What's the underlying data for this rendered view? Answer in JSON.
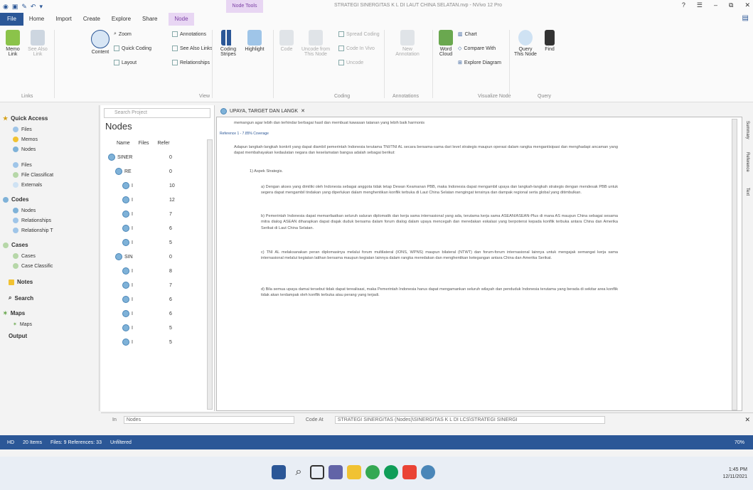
{
  "titlebar": {
    "context_tab": "Node Tools",
    "window_title": "STRATEGI SINERGITAS K L DI LAUT CHINA SELATAN.nvp - NVivo 12 Pro",
    "help": "?",
    "ribbon_opt": "☰",
    "minimize": "–",
    "restore": "⧉",
    "close": "✕"
  },
  "tabs": [
    "File",
    "Home",
    "Import",
    "Create",
    "Explore",
    "Share",
    "Node"
  ],
  "ribbon": {
    "memo_link": "Memo Link",
    "see_also_link": "See Also Link",
    "group_links": "Links",
    "content": "Content",
    "zoom": "Zoom",
    "quick_coding": "Quick Coding",
    "layout": "Layout",
    "annotations": "Annotations",
    "see_also_links": "See Also Links",
    "relationships": "Relationships",
    "group_view": "View",
    "coding_stripes": "Coding Stripes",
    "highlight": "Highlight",
    "code": "Code",
    "uncode_from": "Uncode from This Node",
    "spread_coding": "Spread Coding",
    "code_in_vivo": "Code In Vivo",
    "uncode": "Uncode",
    "group_coding": "Coding",
    "new_annotation": "New Annotation",
    "group_annotations": "Annotations",
    "word_cloud": "Word Cloud",
    "chart": "Chart",
    "compare_with": "Compare With",
    "explore_diagram": "Explore Diagram",
    "group_visualize": "Visualize Node",
    "query_this_node": "Query This Node",
    "find": "Find",
    "group_query": "Query"
  },
  "nav": {
    "quick_access": "Quick Access",
    "files": "Files",
    "memos": "Memos",
    "nodes": "Nodes",
    "files2": "Files",
    "file_classifications": "File Classificat",
    "externals": "Externals",
    "codes": "Codes",
    "nodes2": "Nodes",
    "relationships": "Relationships",
    "relationship_types": "Relationship T",
    "cases": "Cases",
    "cases2": "Cases",
    "case_classifications": "Case Classific",
    "notes": "Notes",
    "search": "Search",
    "maps": "Maps",
    "maps2": "Maps",
    "output": "Output"
  },
  "nodes_pane": {
    "search_placeholder": "Search Project",
    "title": "Nodes",
    "col_name": "Name",
    "col_files": "Files",
    "col_refs": "Refer",
    "rows": [
      {
        "name": "SINER",
        "files": "0"
      },
      {
        "name": "RE",
        "files": "0"
      },
      {
        "name": "I",
        "files": "10"
      },
      {
        "name": "I",
        "files": "12"
      },
      {
        "name": "I",
        "files": "7"
      },
      {
        "name": "I",
        "files": "6"
      },
      {
        "name": "I",
        "files": "5"
      },
      {
        "name": "SIN",
        "files": "0"
      },
      {
        "name": "I",
        "files": "8"
      },
      {
        "name": "I",
        "files": "7"
      },
      {
        "name": "I",
        "files": "6"
      },
      {
        "name": "I",
        "files": "6"
      },
      {
        "name": "I",
        "files": "5"
      },
      {
        "name": "I",
        "files": "5"
      }
    ]
  },
  "document": {
    "tab_title": "UPAYA, TARGET DAN LANGK",
    "top_line": "memangun agar lebih dan terhindar berbagai hasil dan membuat kawasan tatanan yang lebih baik harmonis",
    "ref_header": "Reference 1 - 7.85% Coverage",
    "para1": "Adapun langkah-langkah konkrit yang dapat diambil pemerintah Indonesia terutama TNI/TNI AL secara bersama-sama dari level strategis maupun operasi dalam rangka mengantisipasi dan menghadapi ancaman yang dapat membahayakan kedaulatan negara dan keselamatan bangsa adalah sebagai berikut:",
    "item1": "1)      Aspek Strategis.",
    "para_a": "a)      Dengan akses yang dimiliki oleh Indonesia sebagai anggota tidak tetap Dewan Keamanan PBB, maka Indonesia dapat mengambil upaya dan langkah-langkah strategis dengan mendesak PBB untuk segera dapat mengambil tindakan yang diperlukan dalam menghentikan konflik terbuka di Laut China Selatan mengingat tensinya dan dampak regional serta global yang ditimbulkan.",
    "para_b": "b)      Pemerintah Indonesia dapat memanfaatkan seluruh saluran diplomatik dan kerja sama internasional yang ada, terutama kerja sama ASEAN/ASEAN-Plus di mana AS maupun China sebagai sesama mitra dialog ASEAN diharapkan dapat diajak duduk bersama dalam forum dialog dalam upaya mencegah dan meredakan eskalasi yang berpotensi kepada konflik terbuka antara China dan Amerika Serikat di Laut China Selatan.",
    "para_c": "c)      TNI AL melaksanakan peran diplomasinya melalui forum multilateral (IONS, WPNS) maupun bilateral (NTWT) dan forum-forum internasional lainnya untuk mengajak semangat kerja sama internasional melalui kegiatan latihan bersama maupun kegiatan lainnya dalam rangka meredakan dan menghentikan ketegangan antara China dan Amerika Serikat.",
    "para_d": "d)      Bila semua upaya damai tersebut tidak dapat terealisasi, maka Pemerintah Indonesia harus dapat mengamankan seluruh wilayah dan penduduk Indonesia terutama yang berada di sekitar area konflik tidak akan terdampak oleh konflik terbuka atau perang yang terjadi.",
    "side_summary": "Summary",
    "side_reference": "Reference",
    "side_text": "Text"
  },
  "codebar": {
    "in": "In",
    "nodes": "Nodes",
    "code_at": "Code At",
    "node_path": "STRATEGI SINERGITAS (Nodes)\\SINERGITAS K L DI LCS\\STRATEGI SINERGI"
  },
  "statusbar": {
    "user": "HD",
    "items": "20 Items",
    "files_refs": "Files: 9 References: 33",
    "filter": "Unfiltered",
    "zoom": "70%"
  },
  "taskbar": {
    "time": "1:45 PM",
    "date": "12/11/2021"
  },
  "colors": {
    "accent": "#2b5797",
    "context": "#e8d6f3",
    "highlight": "#c8a0e0"
  }
}
